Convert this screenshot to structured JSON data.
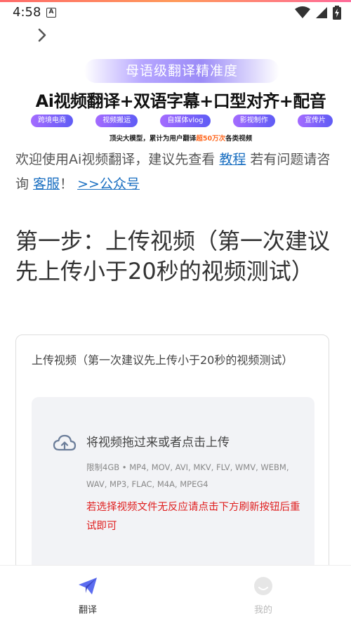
{
  "status_bar": {
    "time": "4:58",
    "notification_icon": "a-badge-icon",
    "icons": [
      "wifi-icon",
      "signal-icon",
      "battery-charging-icon"
    ]
  },
  "header": {
    "back_icon": "chevron-right-icon"
  },
  "banner": {
    "pill_text": "母语级翻译精准度",
    "headline": "Ai视频翻译+双语字幕+口型对齐+配音",
    "tags": [
      "跨境电商",
      "视频搬运",
      "自媒体vlog",
      "影视制作",
      "宣传片"
    ],
    "tagline_prefix": "顶尖大模型，累计为用户翻译",
    "tagline_highlight": "超50万次",
    "tagline_suffix": "各类视频"
  },
  "welcome": {
    "text_1": "欢迎使用Ai视频翻译，建议先查看 ",
    "link_tutorial": "教程",
    "text_2": " 若有问题请咨询 ",
    "link_service": "客服",
    "text_3": "！ ",
    "link_official": ">>公众号"
  },
  "step": {
    "title": "第一步：上传视频（第一次建议先上传小于20秒的视频测试）"
  },
  "upload": {
    "label": "上传视频（第一次建议先上传小于20秒的视频测试）",
    "drop_title": "将视频拖过来或者点击上传",
    "limits": "限制4GB • MP4, MOV, AVI, MKV, FLV, WMV, WEBM, WAV, MP3, FLAC, M4A, MPEG4",
    "warning": "若选择视频文件无反应请点击下方刷新按钮后重试即可"
  },
  "tab_bar": {
    "translate_label": "翻译",
    "mine_label": "我的"
  },
  "colors": {
    "accent_blue": "#5b6cf0",
    "link": "#1a6fc1",
    "warning": "#e02020",
    "highlight": "#ff6a22"
  }
}
